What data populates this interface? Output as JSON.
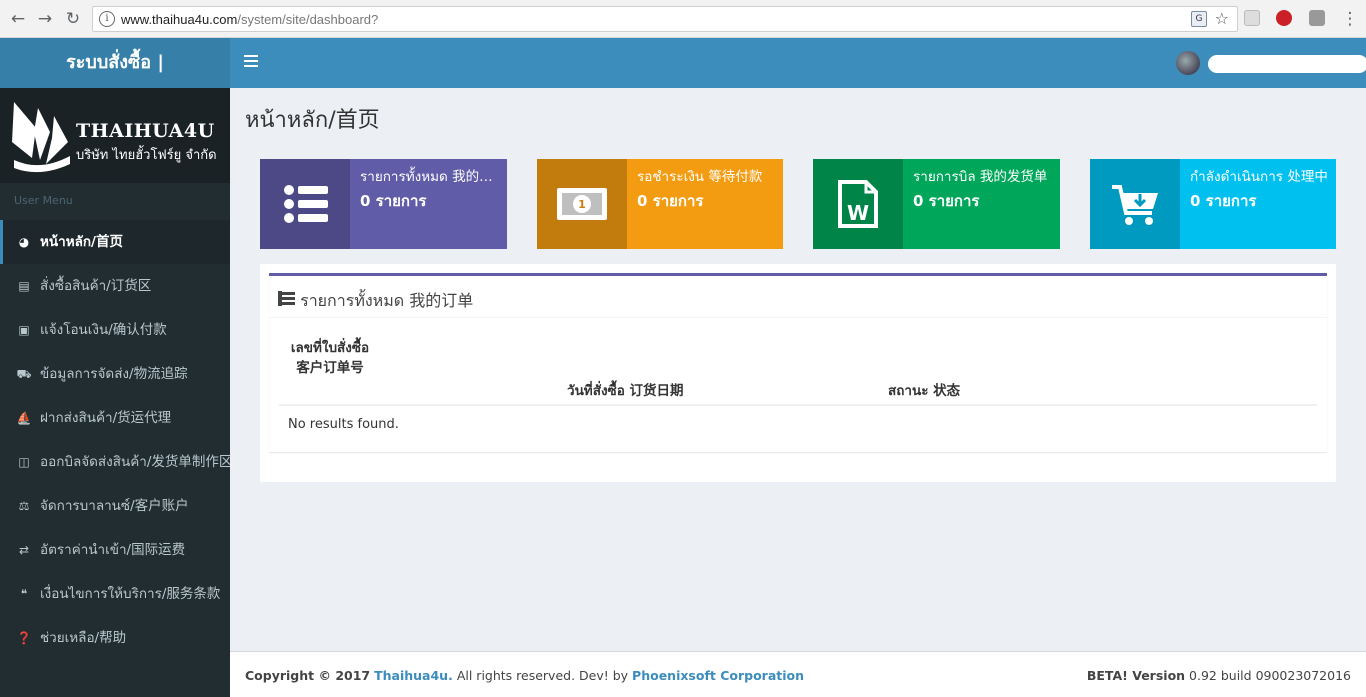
{
  "browser": {
    "url_host": "www.thaihua4u.com",
    "url_path": "/system/site/dashboard?"
  },
  "header": {
    "app_title": "ระบบสั่งซื้อ |"
  },
  "brand": {
    "name": "THAIHUA4U",
    "subtitle": "บริษัท ไทยฮั้วโฟร์ยู จำกัด"
  },
  "sidebar": {
    "section_label": "User Menu",
    "items": [
      {
        "label": "หน้าหลัก/首页",
        "icon": "dashboard-icon",
        "active": true
      },
      {
        "label": "สั่งซื้อสินค้า/订货区",
        "icon": "basket-icon"
      },
      {
        "label": "แจ้งโอนเงิน/确认付款",
        "icon": "money-icon"
      },
      {
        "label": "ข้อมูลการจัดส่ง/物流追踪",
        "icon": "truck-icon"
      },
      {
        "label": "ฝากส่งสินค้า/货运代理",
        "icon": "ship-icon"
      },
      {
        "label": "ออกบิลจัดส่งสินค้า/发货单制作区",
        "icon": "word-file-icon"
      },
      {
        "label": "จัดการบาลานซ์/客户账户",
        "icon": "balance-scale-icon"
      },
      {
        "label": "อัตราค่านำเข้า/国际运费",
        "icon": "exchange-icon"
      },
      {
        "label": "เงื่อนไขการให้บริการ/服务条款",
        "icon": "quote-icon"
      },
      {
        "label": "ช่วยเหลือ/帮助",
        "icon": "question-icon"
      }
    ]
  },
  "main": {
    "page_title": "หน้าหลัก/首页",
    "info_boxes": [
      {
        "label": "รายการทั้งหมด 我的订单",
        "count": "0 รายการ",
        "color": "#605ca8",
        "icon": "list-icon"
      },
      {
        "label": "รอชำระเงิน 等待付款",
        "count": "0 รายการ",
        "color": "#f39c12",
        "icon": "money-icon"
      },
      {
        "label": "รายการบิล 我的发货单",
        "count": "0 รายการ",
        "color": "#00a65a",
        "icon": "word-file-icon"
      },
      {
        "label": "กำลังดำเนินการ 处理中",
        "count": "0 รายการ",
        "color": "#00c0ef",
        "icon": "cart-download-icon"
      }
    ],
    "orders_box": {
      "title": "รายการทั้งหมด 我的订单",
      "columns": [
        "เลขที่ใบสั่งซื้อ客户订单号",
        "วันที่สั่งซื้อ 订货日期",
        "สถานะ 状态"
      ],
      "empty_text": "No results found."
    }
  },
  "footer": {
    "copyright_prefix": "Copyright © 2017",
    "company_link": "Thaihua4u.",
    "rights_text": "All rights reserved. Dev! by",
    "dev_link": "Phoenixsoft Corporation",
    "version_label": "BETA! Version",
    "version_value": "0.92 build 090023072016"
  },
  "colors": {
    "header": "#3c8dbc",
    "logo_bar": "#367fa9",
    "sidebar": "#222d32"
  }
}
